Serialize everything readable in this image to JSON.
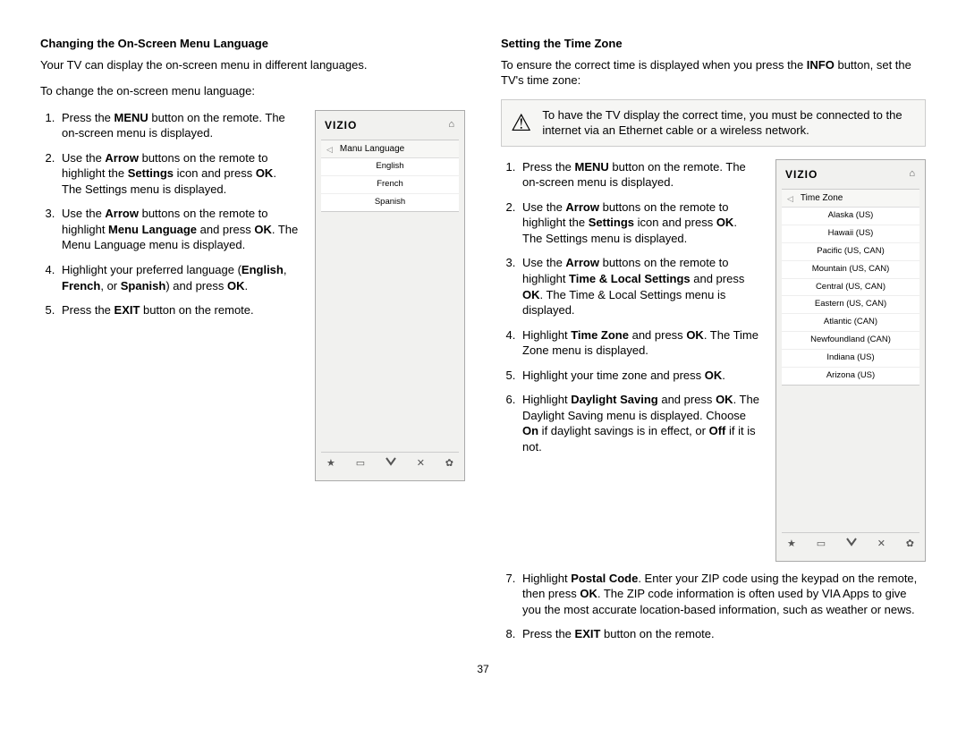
{
  "page_number": "37",
  "left": {
    "heading": "Changing the On-Screen Menu Language",
    "intro": "Your TV can display the on-screen menu in different languages.",
    "intro2": "To change the on-screen menu language:",
    "steps": {
      "s1_a": "Press the ",
      "s1_b": "MENU",
      "s1_c": " button on the remote. The on-screen menu is displayed.",
      "s2_a": "Use the ",
      "s2_b": "Arrow",
      "s2_c": " buttons on the remote to highlight the ",
      "s2_d": "Settings",
      "s2_e": " icon and press ",
      "s2_f": "OK",
      "s2_g": ". The Settings menu is displayed.",
      "s3_a": "Use the ",
      "s3_b": "Arrow",
      "s3_c": " buttons on the remote to highlight ",
      "s3_d": "Menu Language",
      "s3_e": " and press ",
      "s3_f": "OK",
      "s3_g": ". The Menu Language menu is displayed.",
      "s4_a": "Highlight your preferred language (",
      "s4_b": "English",
      "s4_c": ", ",
      "s4_d": "French",
      "s4_e": ", or ",
      "s4_f": "Spanish",
      "s4_g": ") and press ",
      "s4_h": "OK",
      "s4_i": ".",
      "s5_a": "Press the ",
      "s5_b": "EXIT",
      "s5_c": " button on the remote."
    },
    "screen": {
      "brand": "VIZIO",
      "menu_title": "Manu Language",
      "items": [
        "English",
        "French",
        "Spanish"
      ]
    }
  },
  "right": {
    "heading": "Setting the Time Zone",
    "intro_a": "To ensure the correct time is displayed when you press the ",
    "intro_b": "INFO",
    "intro_c": " button, set the TV's time zone:",
    "warning": "To have the TV display the correct time, you must be connected to the internet via an Ethernet cable or a wireless network.",
    "steps": {
      "s1_a": "Press the ",
      "s1_b": "MENU",
      "s1_c": " button on the remote. The on-screen menu is displayed.",
      "s2_a": "Use the ",
      "s2_b": "Arrow",
      "s2_c": " buttons on the remote to highlight the ",
      "s2_d": "Settings",
      "s2_e": " icon and press ",
      "s2_f": "OK",
      "s2_g": ". The Settings menu is displayed.",
      "s3_a": "Use the ",
      "s3_b": "Arrow",
      "s3_c": " buttons on the remote to highlight ",
      "s3_d": "Time & Local Settings",
      "s3_e": " and press ",
      "s3_f": "OK",
      "s3_g": ". The Time & Local Settings menu is displayed.",
      "s4_a": "Highlight ",
      "s4_b": "Time Zone",
      "s4_c": " and press ",
      "s4_d": "OK",
      "s4_e": ". The Time Zone menu is displayed.",
      "s5_a": "Highlight your time zone and press ",
      "s5_b": "OK",
      "s5_c": ".",
      "s6_a": "Highlight ",
      "s6_b": "Daylight Saving",
      "s6_c": " and press ",
      "s6_d": "OK",
      "s6_e": ". The Daylight Saving menu is displayed. Choose ",
      "s6_f": "On",
      "s6_g": " if daylight savings is in effect, or ",
      "s6_h": "Off",
      "s6_i": " if it is not.",
      "s7_a": "Highlight ",
      "s7_b": "Postal Code",
      "s7_c": ". Enter your ZIP code using the keypad on the remote, then press ",
      "s7_d": "OK",
      "s7_e": ". The ZIP code information is often used by VIA Apps to give you the most accurate location-based information, such as weather or news.",
      "s8_a": "Press the ",
      "s8_b": "EXIT",
      "s8_c": " button on the remote."
    },
    "screen": {
      "brand": "VIZIO",
      "menu_title": "Time Zone",
      "items": [
        "Alaska (US)",
        "Hawaii (US)",
        "Pacific (US, CAN)",
        "Mountain (US, CAN)",
        "Central (US, CAN)",
        "Eastern (US, CAN)",
        "Atlantic (CAN)",
        "Newfoundland (CAN)",
        "Indiana (US)",
        "Arizona (US)"
      ]
    }
  },
  "footer_icons": {
    "star": "★",
    "wide": "▭",
    "v": "❤",
    "x": "✕",
    "gear": "✿"
  }
}
